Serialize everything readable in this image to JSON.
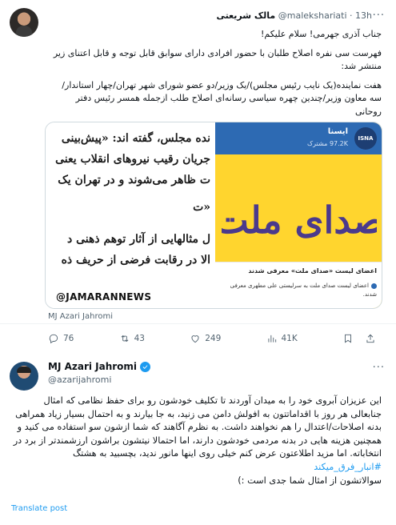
{
  "tweet": {
    "author_name": "مالک شریعتی",
    "handle": "@malekshariati",
    "time": "13h",
    "paragraphs": [
      "جناب آذری جهرمی! سلام علیکم!",
      "فهرست سی نفره اصلاح طلبان با حضور افرادی دارای سوابق قابل توجه و قابل اعتنای زیر منتشر شد:",
      "هفت نماینده(یک نایب رئیس مجلس)/یک وزیر/دو عضو شورای شهر تهران/چهار استاندار/ سه معاون وزیر/چندین چهره سیاسی رسانه‌ای اصلاح طلب ازجمله همسر رئیس دفتر روحانی"
    ],
    "media": {
      "news_lines": [
        "نده مجلس، گفته اند: «پیش‌بینی",
        "جریان رقیب نیروهای انقلاب یعنی",
        "ت ظاهر می‌شوند و در تهران یک",
        "«ت",
        "ل مثالهایی از آثار توهم ذهنی د",
        "الا در رقابت فرضی از حریف ذه"
      ],
      "watermark": "@JAMARANNEWS",
      "isna_name": "ایسنا",
      "isna_followers": "97.2K مشترک",
      "isna_logo": "ISNA",
      "logo_art_text": "صدای ملت",
      "caption_title": "اعضای لیست «صدای ملت» معرفی شدند",
      "caption_body": "اعضای لیست صدای ملت به سرلیستی علی مطهری معرفی شدند."
    },
    "alt_label": "MJ Azari Jahromi",
    "stats": {
      "replies": "76",
      "retweets": "43",
      "likes": "249",
      "views": "41K"
    }
  },
  "reply": {
    "author_name": "MJ Azari Jahromi",
    "handle": "@azarijahromi",
    "body_before": "این عزیزان آبروی خود را به میدان آوردند تا تکلیف خودشون رو برای حفظ نظامی که امثال جنابعالی هر روز با اقداماتتون به افولش دامن می زنید، به جا بیارند و به احتمال بسیار زیاد همراهی بدنه اصلاحات/اعتدال را هم نخواهند داشت. به نظرم آگاهند که شما ازشون سو استفاده می کنید و همچنین هزینه هایی در بدنه مردمی خودشون دارند، اما احتمالا نیتشون براشون ارزشمندتر از برد در انتخاباته. اما مزید اطلاعتون عرض کنم خیلی روی اینها مانور ندید، بچسبید به هشتگ ",
    "hashtag": "#انبار_فرق_میکند",
    "body_after": "سوالاتشون از امثال شما جدی است :)",
    "translate": "Translate post"
  },
  "colors": {
    "accent": "#1d9bf0",
    "muted": "#536471",
    "isna_yellow": "#ffd52e",
    "isna_blue": "#2d6ab3",
    "logo_purple": "#4b3a8c"
  },
  "icons": [
    "more-icon",
    "reply-icon",
    "retweet-icon",
    "like-icon",
    "views-icon",
    "bookmark-icon",
    "share-icon",
    "verified-icon"
  ]
}
